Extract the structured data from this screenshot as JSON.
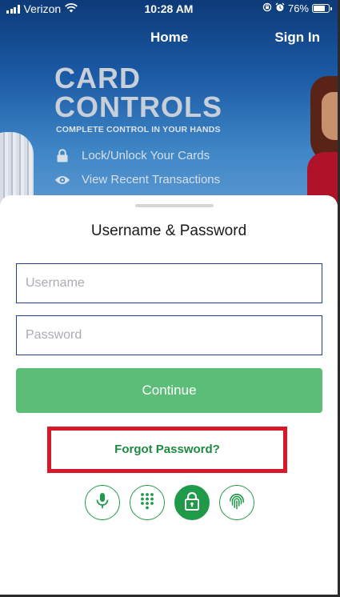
{
  "status_bar": {
    "carrier": "Verizon",
    "time": "10:28 AM",
    "battery": "76%"
  },
  "nav": {
    "home": "Home",
    "sign_in": "Sign In"
  },
  "banner": {
    "title_line1": "CARD",
    "title_line2": "CONTROLS",
    "subtitle": "COMPLETE CONTROL IN YOUR HANDS",
    "feature1": "Lock/Unlock Your Cards",
    "feature2": "View Recent Transactions"
  },
  "login": {
    "title": "Username & Password",
    "username_placeholder": "Username",
    "password_placeholder": "Password",
    "continue_label": "Continue",
    "forgot_label": "Forgot Password?"
  },
  "auth_methods": [
    "microphone-icon",
    "keypad-icon",
    "lock-icon",
    "fingerprint-icon"
  ],
  "active_method": "lock-icon",
  "colors": {
    "brand_green": "#1f9a49",
    "button_green": "#5bbd78",
    "header_blue": "#1b4f96",
    "highlight_red": "#d8192a"
  }
}
